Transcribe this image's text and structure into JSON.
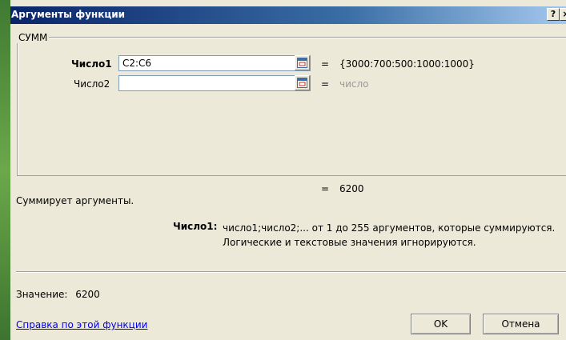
{
  "window": {
    "title": "Аргументы функции",
    "help_button": "?",
    "close_button": "×"
  },
  "function": {
    "name": "СУММ",
    "arguments": [
      {
        "label": "Число1",
        "value": "C2:C6",
        "result": "{3000:700:500:1000:1000}",
        "result_style": "normal"
      },
      {
        "label": "Число2",
        "value": "",
        "result": "число",
        "result_style": "placeholder"
      }
    ],
    "equals": "=",
    "formula_result": "6200",
    "description": "Суммирует аргументы.",
    "arg_description": {
      "label": "Число1:",
      "line1": "число1;число2;... от 1 до 255 аргументов, которые суммируются.",
      "line2": "Логические и текстовые значения игнорируются."
    }
  },
  "footer": {
    "value_label": "Значение:",
    "value": "6200",
    "help_link": "Справка по этой функции",
    "ok_label": "OK",
    "cancel_label": "Отмена"
  },
  "colors": {
    "titlebar_start": "#0a246a",
    "titlebar_end": "#a6caf0",
    "dialog_bg": "#ece9d8",
    "placeholder_text": "#9a9a9a",
    "link": "#0000ee"
  },
  "icons": {
    "collapse_dialog": "collapse-dialog-icon"
  }
}
